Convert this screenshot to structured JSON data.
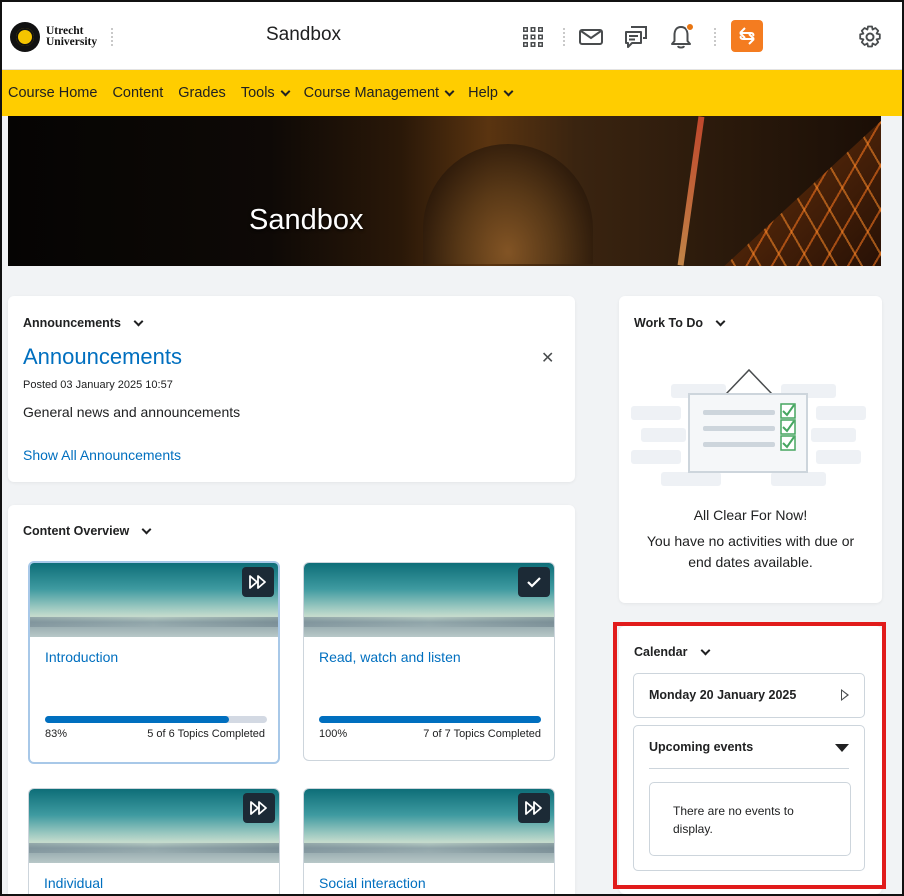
{
  "header": {
    "logo_text_line1": "Utrecht",
    "logo_text_line2": "University",
    "site_title": "Sandbox",
    "icons": [
      "apps-grid-icon",
      "mail-icon",
      "chat-icon",
      "bell-icon",
      "role-switch-icon",
      "gear-icon"
    ],
    "accent_color": "#f47c20"
  },
  "nav": {
    "items": [
      {
        "label": "Course Home",
        "dropdown": false
      },
      {
        "label": "Content",
        "dropdown": false
      },
      {
        "label": "Grades",
        "dropdown": false
      },
      {
        "label": "Tools",
        "dropdown": true
      },
      {
        "label": "Course Management",
        "dropdown": true
      },
      {
        "label": "Help",
        "dropdown": true
      }
    ],
    "background": "#ffcd00"
  },
  "banner": {
    "title": "Sandbox"
  },
  "announcements": {
    "widget_title": "Announcements",
    "heading": "Announcements",
    "posted": "Posted 03 January 2025 10:57",
    "body": "General news and announcements",
    "link": "Show All Announcements",
    "close_glyph": "✕"
  },
  "content_overview": {
    "widget_title": "Content Overview",
    "tiles": [
      {
        "name": "Introduction",
        "percent": "83%",
        "progress": 0.83,
        "count": "5 of 6 Topics Completed",
        "badge": "skip-forward-icon"
      },
      {
        "name": "Read, watch and listen",
        "percent": "100%",
        "progress": 1.0,
        "count": "7 of 7 Topics Completed",
        "badge": "checkmark-icon"
      },
      {
        "name": "Individual",
        "badge": "skip-forward-icon"
      },
      {
        "name": "Social interaction",
        "badge": "skip-forward-icon"
      }
    ]
  },
  "work_to_do": {
    "widget_title": "Work To Do",
    "empty_title": "All Clear For Now!",
    "empty_line1": "You have no activities with due or",
    "empty_line2": "end dates available."
  },
  "calendar": {
    "widget_title": "Calendar",
    "date": "Monday 20 January 2025",
    "upcoming_title": "Upcoming events",
    "empty_message": "There are no events to display.",
    "highlight_color": "#e11b1b"
  }
}
